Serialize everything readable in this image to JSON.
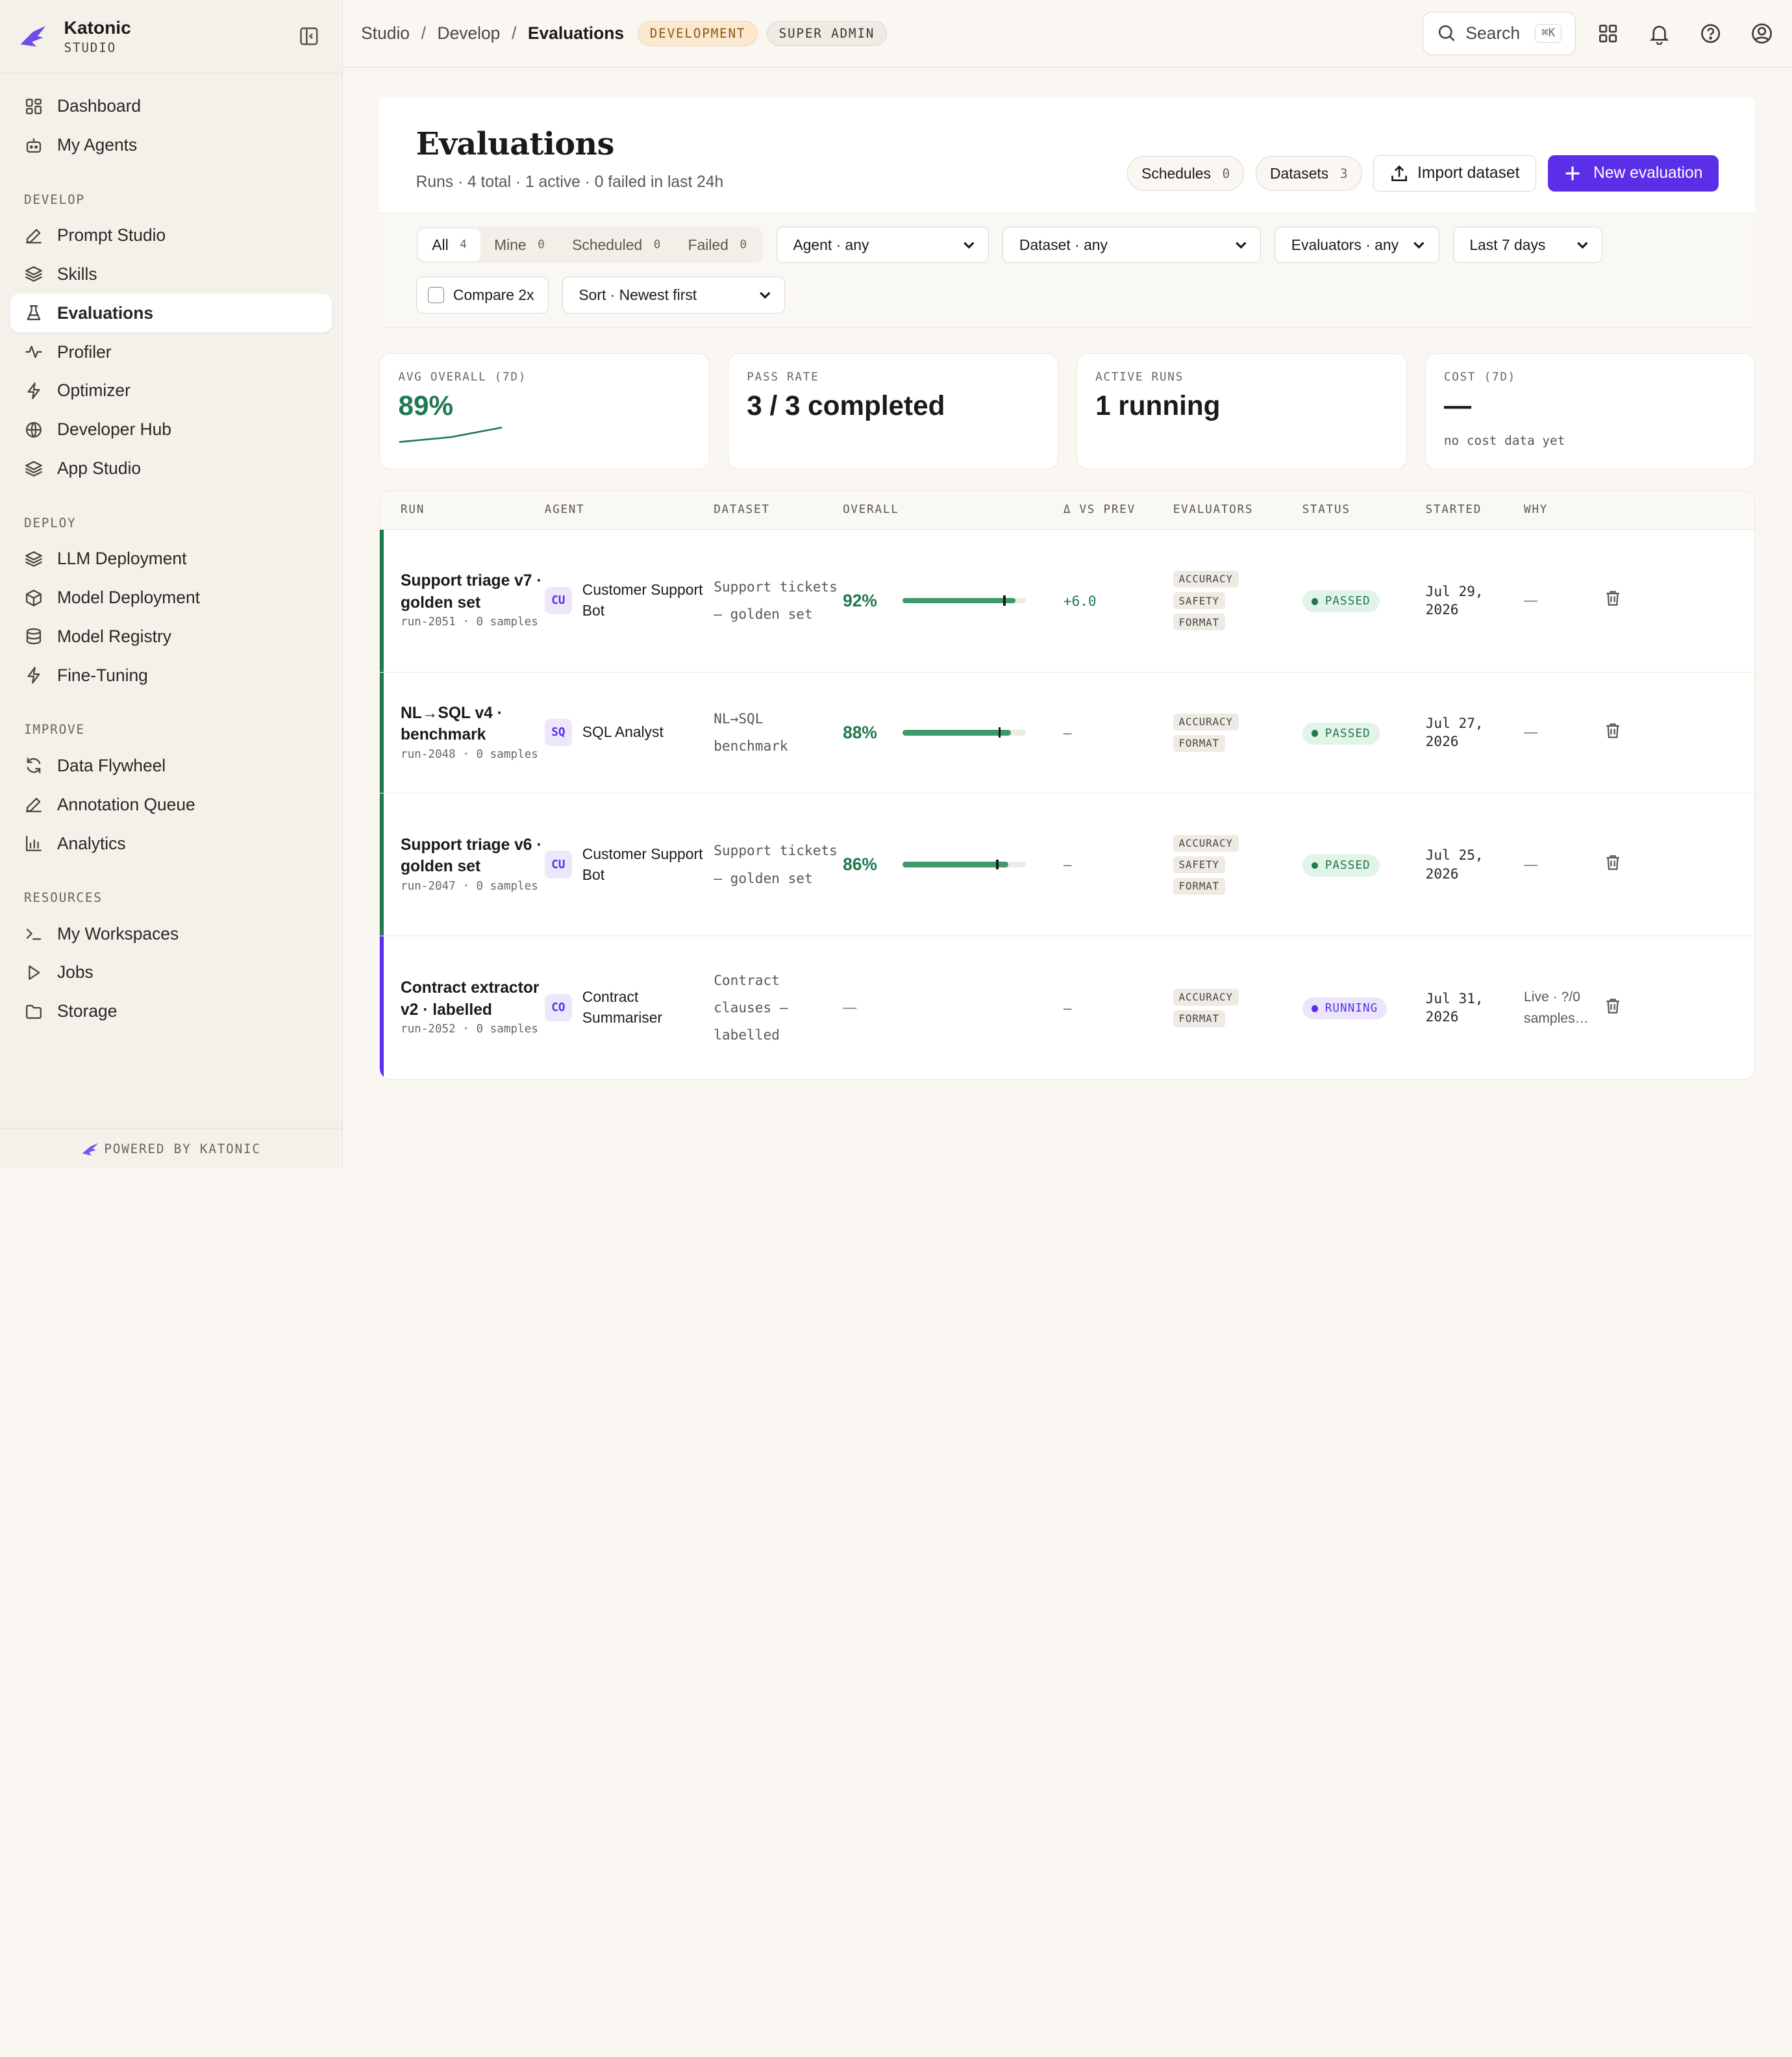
{
  "brand": {
    "name": "Katonic",
    "sub": "STUDIO"
  },
  "sidebar": {
    "top": [
      {
        "label": "Dashboard",
        "icon": "dashboard-icon"
      },
      {
        "label": "My Agents",
        "icon": "bot-icon"
      }
    ],
    "sections": [
      {
        "title": "DEVELOP",
        "items": [
          {
            "label": "Prompt Studio",
            "icon": "edit-icon"
          },
          {
            "label": "Skills",
            "icon": "layers-icon"
          },
          {
            "label": "Evaluations",
            "icon": "flask-icon",
            "active": true
          },
          {
            "label": "Profiler",
            "icon": "activity-icon"
          },
          {
            "label": "Optimizer",
            "icon": "bolt-icon"
          },
          {
            "label": "Developer Hub",
            "icon": "globe-icon"
          },
          {
            "label": "App Studio",
            "icon": "layers-icon"
          }
        ]
      },
      {
        "title": "DEPLOY",
        "items": [
          {
            "label": "LLM Deployment",
            "icon": "layers-icon"
          },
          {
            "label": "Model Deployment",
            "icon": "cube-icon"
          },
          {
            "label": "Model Registry",
            "icon": "database-icon"
          },
          {
            "label": "Fine-Tuning",
            "icon": "bolt-icon"
          }
        ]
      },
      {
        "title": "IMPROVE",
        "items": [
          {
            "label": "Data Flywheel",
            "icon": "refresh-icon"
          },
          {
            "label": "Annotation Queue",
            "icon": "edit-icon"
          },
          {
            "label": "Analytics",
            "icon": "bar-chart-icon"
          }
        ]
      },
      {
        "title": "RESOURCES",
        "items": [
          {
            "label": "My Workspaces",
            "icon": "terminal-icon"
          },
          {
            "label": "Jobs",
            "icon": "play-icon"
          },
          {
            "label": "Storage",
            "icon": "folder-icon"
          }
        ]
      }
    ],
    "footer": "POWERED BY KATONIC"
  },
  "topbar": {
    "crumbs": [
      "Studio",
      "Develop",
      "Evaluations"
    ],
    "env_badge": "DEVELOPMENT",
    "role_badge": "SUPER ADMIN",
    "search_label": "Search",
    "search_kbd": "⌘K"
  },
  "page": {
    "title": "Evaluations",
    "subtitle": "Runs · 4 total · 1 active · 0 failed in last 24h",
    "schedules_label": "Schedules",
    "schedules_count": "0",
    "datasets_label": "Datasets",
    "datasets_count": "3",
    "import_label": "Import dataset",
    "new_label": "New evaluation"
  },
  "filters": {
    "tabs": [
      {
        "label": "All",
        "count": "4",
        "active": true
      },
      {
        "label": "Mine",
        "count": "0"
      },
      {
        "label": "Scheduled",
        "count": "0"
      },
      {
        "label": "Failed",
        "count": "0"
      }
    ],
    "agent": "Agent · any",
    "dataset": "Dataset · any",
    "evaluators": "Evaluators · any",
    "range": "Last 7 days",
    "compare": "Compare 2x",
    "sort": "Sort · Newest first"
  },
  "stats": {
    "avg_label": "AVG OVERALL (7D)",
    "avg_value": "89%",
    "avg_trend": [
      86,
      88,
      92
    ],
    "pass_label": "PASS RATE",
    "pass_value": "3 / 3 completed",
    "active_label": "ACTIVE RUNS",
    "active_value": "1 running",
    "cost_label": "COST (7D)",
    "cost_value": "—",
    "cost_note": "no cost data yet"
  },
  "table": {
    "headers": [
      "RUN",
      "AGENT",
      "DATASET",
      "OVERALL",
      "Δ VS PREV",
      "EVALUATORS",
      "STATUS",
      "STARTED",
      "WHY"
    ],
    "rows": [
      {
        "name": "Support triage v7 · golden set",
        "meta": "run-2051 · 0 samples",
        "agent_code": "CU",
        "agent": "Customer Support Bot",
        "dataset": "Support tickets — golden set",
        "overall": "92%",
        "overall_value": 0.92,
        "delta": "+6.0",
        "evaluators": [
          "ACCURACY",
          "SAFETY",
          "FORMAT"
        ],
        "status": "PASSED",
        "status_kind": "passed",
        "started": "Jul 29, 2026",
        "why": "—",
        "bar_color": "#1f7a4e"
      },
      {
        "name": "NL→SQL v4 · benchmark",
        "meta": "run-2048 · 0 samples",
        "agent_code": "SQ",
        "agent": "SQL Analyst",
        "dataset": "NL→SQL benchmark",
        "overall": "88%",
        "overall_value": 0.88,
        "delta": "—",
        "evaluators": [
          "ACCURACY",
          "FORMAT"
        ],
        "status": "PASSED",
        "status_kind": "passed",
        "started": "Jul 27, 2026",
        "why": "—",
        "bar_color": "#1f7a4e"
      },
      {
        "name": "Support triage v6 · golden set",
        "meta": "run-2047 · 0 samples",
        "agent_code": "CU",
        "agent": "Customer Support Bot",
        "dataset": "Support tickets — golden set",
        "overall": "86%",
        "overall_value": 0.86,
        "delta": "—",
        "evaluators": [
          "ACCURACY",
          "SAFETY",
          "FORMAT"
        ],
        "status": "PASSED",
        "status_kind": "passed",
        "started": "Jul 25, 2026",
        "why": "—",
        "bar_color": "#1f7a4e"
      },
      {
        "name": "Contract extractor v2 · labelled",
        "meta": "run-2052 · 0 samples",
        "agent_code": "CO",
        "agent": "Contract Summariser",
        "dataset": "Contract clauses — labelled",
        "overall": "—",
        "overall_value": null,
        "delta": "—",
        "evaluators": [
          "ACCURACY",
          "FORMAT"
        ],
        "status": "RUNNING",
        "status_kind": "running",
        "started": "Jul 31, 2026",
        "why": "Live · ?/0 samples…",
        "bar_color": "#5b2ee8"
      }
    ]
  }
}
